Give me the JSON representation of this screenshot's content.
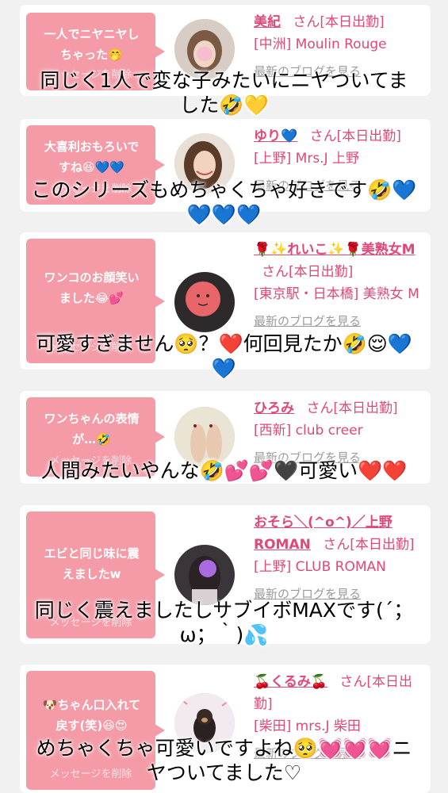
{
  "bubble_delete_label": "メッセージを削除",
  "san_suffix": "さん",
  "blog_link_label": "最新のブログを見る",
  "colors": {
    "bubble": "#f49ba7",
    "accent": "#e04877",
    "background": "#f1f1f1",
    "link_gray": "#9a9a9a"
  },
  "cards": [
    {
      "message": "一人でニヤニヤし\nちゃった🤭",
      "name": "美紀",
      "status": "[本日出勤]",
      "shop": "[中洲] Moulin Rouge",
      "avatar_icon": "woman-avatar-icon"
    },
    {
      "message": "大喜利おもろいで\nすね😆💙💙",
      "name": "ゆり💙",
      "status": "[本日出勤]",
      "shop": "[上野] Mrs.J 上野",
      "avatar_icon": "woman-avatar-icon"
    },
    {
      "message": "ワンコのお顔笑い\nました😂💕",
      "name": "🌹✨れいこ✨🌹美熟女M",
      "status": "[本日出勤]",
      "shop": "[東京駅・日本橋] 美熟女 M",
      "avatar_icon": "pink-avatar-icon"
    },
    {
      "message": "ワンちゃんの表情\nが…🤣",
      "name": "ひろみ",
      "status": "[本日出勤]",
      "shop": "[西新] club creer",
      "avatar_icon": "feet-avatar-icon"
    },
    {
      "message": "エビと同じ味に震\nえましたw",
      "name": "おそら＼(^o^)／上野ROMAN",
      "status": "[本日出勤]",
      "shop": "[上野] CLUB ROMAN",
      "avatar_icon": "woman-avatar-icon"
    },
    {
      "message": "🐶ちゃん口入れて\n戻す(笑)😆😍",
      "name": "🍒くるみ🍒",
      "status": "[本日出勤]",
      "shop": "[柴田] mrs.J 柴田",
      "avatar_icon": "dog-avatar-icon"
    }
  ],
  "overlays": [
    "同じく1人で変な子みたいにニヤついてま\nした🤣💛",
    "このシリーズもめちゃくちゃ好きです🤣💙\n💙💙💙",
    "可愛すぎません🥺？❤️何回見たか🤣😌💙\n💙",
    "人間みたいやんな🤣💕💕🖤可愛い❤️❤️",
    "同じく震えましたしサブイボMAXです(´；\nω；｀)💦",
    "めちゃくちゃ可愛いですよね🥺💓💓💓ニ\nヤついてました♡"
  ]
}
